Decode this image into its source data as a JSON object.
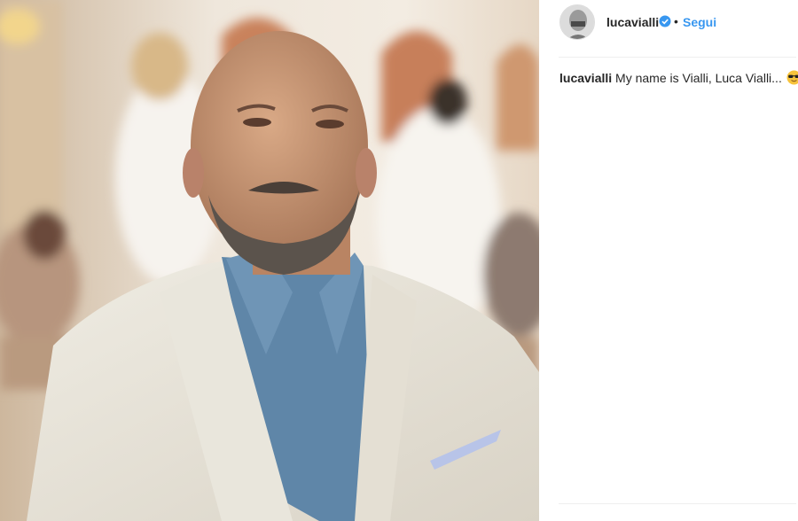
{
  "post": {
    "username": "lucavialli",
    "follow_label": "Segui",
    "separator": "•",
    "verified_icon": "verified-badge-icon",
    "caption_user": "lucavialli",
    "caption_text": "My name is Vialli, Luca Vialli...",
    "caption_emoji": "smiling-face-with-sunglasses"
  },
  "colors": {
    "link_blue": "#3897f0",
    "text": "#262626",
    "divider": "#efefef"
  }
}
